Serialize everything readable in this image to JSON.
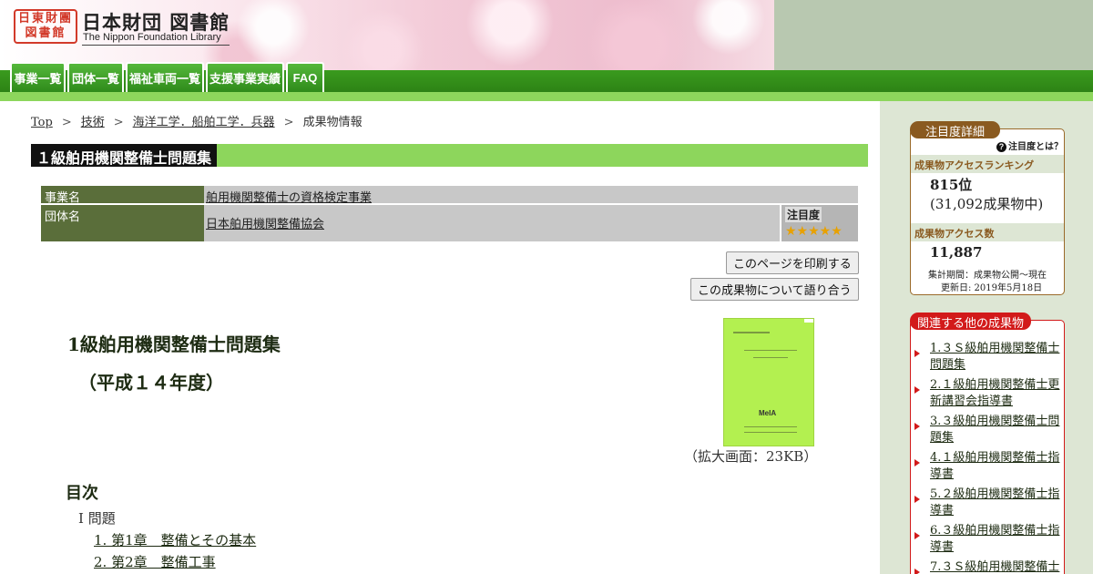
{
  "header": {
    "seal_top": "日東財團",
    "seal_bottom": "図書館",
    "logo_jp": "日本財団 図書館",
    "logo_en": "The Nippon Foundation Library"
  },
  "nav": {
    "tabs": [
      "事業一覧",
      "団体一覧",
      "福祉車両一覧",
      "支援事業実績",
      "FAQ"
    ]
  },
  "breadcrumb": {
    "items": [
      "Top",
      "技術",
      "海洋工学．船舶工学．兵器"
    ],
    "current": "成果物情報",
    "separator": ">"
  },
  "page_title": "１級舶用機関整備士問題集",
  "info": {
    "project_label": "事業名",
    "project_value": "舶用機関整備士の資格検定事業",
    "org_label": "団体名",
    "org_value": "日本舶用機関整備協会",
    "attention_label": "注目度",
    "attention_stars": "★★★★★",
    "attention_rating": 5
  },
  "buttons": {
    "print": "このページを印刷する",
    "discuss": "この成果物について語り合う"
  },
  "document": {
    "title": "1級舶用機関整備士問題集",
    "subtitle": "（平成１４年度）",
    "thumbnail_caption": "（拡大画面：23KB）",
    "thumbnail_logo": "MeIA"
  },
  "toc": {
    "heading": "目次",
    "section": "I 問題",
    "items": [
      "1. 第1章　整備とその基本",
      "2. 第2章　整備工事"
    ]
  },
  "sidebar": {
    "attention_panel": {
      "tab": "注目度詳細",
      "help": "注目度とは？",
      "ranking_label": "成果物アクセスランキング",
      "ranking_value": "815位",
      "ranking_total": "(31,092成果物中)",
      "access_label": "成果物アクセス数",
      "access_value": "11,887",
      "period": "集計期間：成果物公開～現在",
      "updated": "更新日: 2019年5月18日"
    },
    "related_panel": {
      "tab": "関連する他の成果物",
      "items": [
        "1.３Ｓ級舶用機関整備士問題集",
        "2.１級舶用機関整備士更新講習会指導書",
        "3.３級舶用機関整備士問題集",
        "4.１級舶用機関整備士指導書",
        "5.２級舶用機関整備士指導書",
        "6.３級舶用機関整備士指導書",
        "7.３Ｓ級舶用機関整備士"
      ]
    }
  },
  "colors": {
    "nav_green": "#2e8a1a",
    "light_green": "#8dd65c",
    "label_green": "#5a6e3a",
    "panel_brown": "#8a5a20",
    "panel_red": "#d21a1a"
  }
}
